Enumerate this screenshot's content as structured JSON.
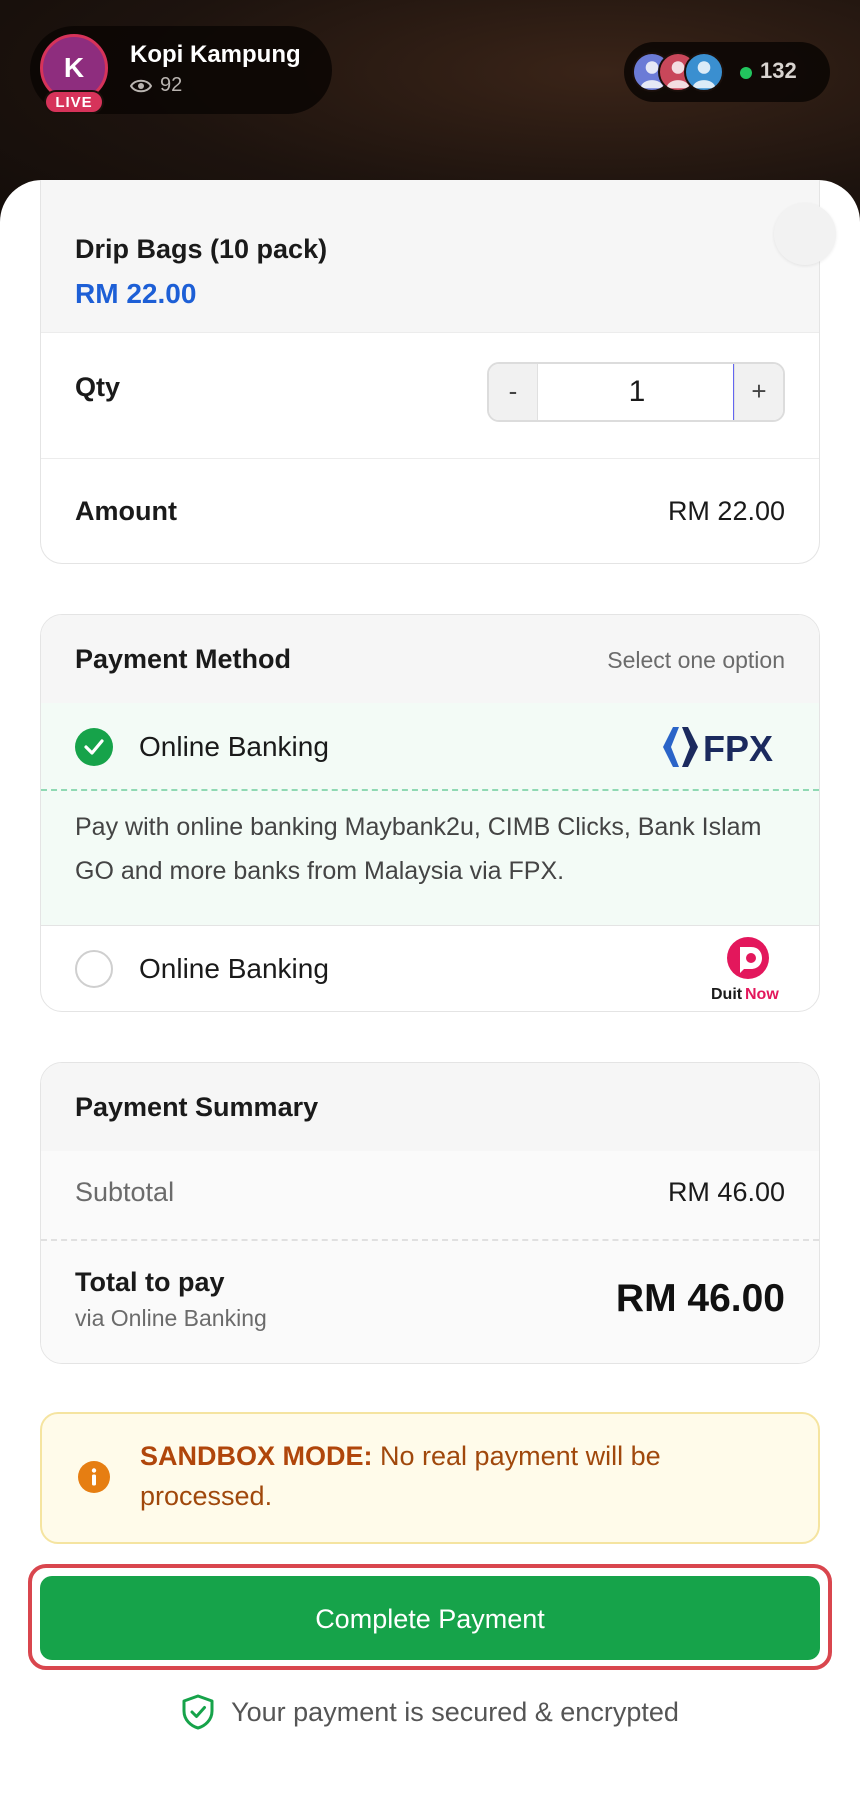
{
  "header": {
    "host_initial": "K",
    "host_name": "Kopi Kampung",
    "live_label": "LIVE",
    "viewer_count": "92",
    "online_count": "132",
    "avatar_color": "#8e2d7e",
    "live_color": "#d6335a"
  },
  "product": {
    "name": "Drip Bags (10 pack)",
    "price": "RM 22.00",
    "qty_label": "Qty",
    "minus_label": "-",
    "plus_label": "+",
    "qty_value": "1",
    "amount_label": "Amount",
    "amount_value": "RM 22.00"
  },
  "payment_method": {
    "title": "Payment Method",
    "hint": "Select one option",
    "options": [
      {
        "label": "Online Banking",
        "selected": true,
        "logo": "fpx-logo",
        "logo_text": "FPX",
        "description": "Pay with online banking Maybank2u, CIMB Clicks, Bank Islam GO and more banks from Malaysia via FPX."
      },
      {
        "label": "Online Banking",
        "selected": false,
        "logo": "duitnow-logo",
        "logo_text_a": "Duit",
        "logo_text_b": "Now"
      }
    ]
  },
  "summary": {
    "title": "Payment Summary",
    "subtotal_label": "Subtotal",
    "subtotal_value": "RM 46.00",
    "total_label": "Total to pay",
    "total_sub": "via Online Banking",
    "total_value": "RM 46.00"
  },
  "notice": {
    "strong": "SANDBOX MODE:",
    "text": " No real payment will be processed."
  },
  "actions": {
    "pay_label": "Complete Payment",
    "secure_text": "Your payment is secured & encrypted"
  },
  "colors": {
    "accent_green": "#16a34a",
    "price_blue": "#1d5fd6",
    "warning_text": "#a0480c",
    "highlight_red": "#d9464e"
  }
}
